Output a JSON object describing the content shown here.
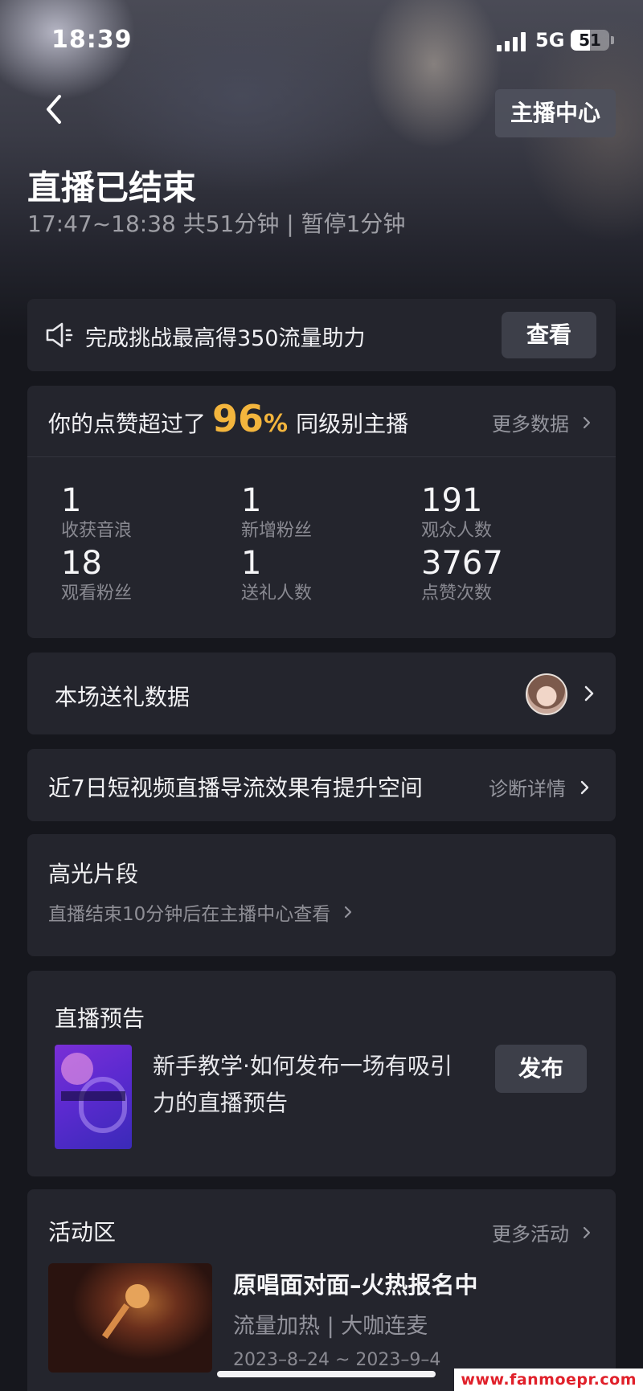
{
  "status_bar": {
    "time": "18:39",
    "network": "5G",
    "battery": "51",
    "battery_level": 0.51
  },
  "header": {
    "anchor_center_label": "主播中心",
    "title": "直播已结束",
    "duration": "17:47~18:38 共51分钟 | 暂停1分钟"
  },
  "challenge": {
    "text": "完成挑战最高得350流量助力",
    "button_label": "查看"
  },
  "stats": {
    "like_prefix": "你的点赞超过了",
    "like_percent": "96",
    "like_percent_sign": "%",
    "like_suffix": "同级别主播",
    "more_label": "更多数据",
    "items": [
      {
        "value": "1",
        "label": "收获音浪"
      },
      {
        "value": "1",
        "label": "新增粉丝"
      },
      {
        "value": "191",
        "label": "观众人数"
      },
      {
        "value": "18",
        "label": "观看粉丝"
      },
      {
        "value": "1",
        "label": "送礼人数"
      },
      {
        "value": "3767",
        "label": "点赞次数"
      }
    ]
  },
  "gift": {
    "title": "本场送礼数据"
  },
  "diagnosis": {
    "title": "近7日短视频直播导流效果有提升空间",
    "link_label": "诊断详情"
  },
  "highlight": {
    "title": "高光片段",
    "subtitle": "直播结束10分钟后在主播中心查看"
  },
  "preview": {
    "title": "直播预告",
    "description": "新手教学·如何发布一场有吸引力的直播预告",
    "button_label": "发布"
  },
  "activity": {
    "title": "活动区",
    "more_label": "更多活动",
    "item_title": "原唱面对面–火热报名中",
    "item_tags": "流量加热 | 大咖连麦",
    "item_dates": "2023–8–24 ~ 2023–9–4"
  },
  "watermark": "www.fanmoepr.com",
  "colors": {
    "accent": "#f3b53d",
    "card": "#24252d",
    "background": "#16171d"
  }
}
